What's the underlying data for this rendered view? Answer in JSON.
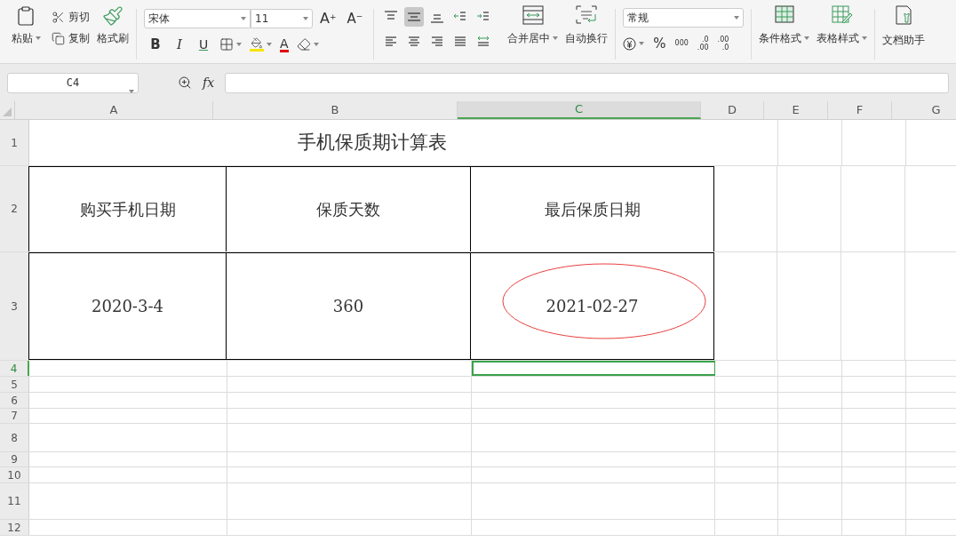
{
  "toolbar": {
    "clipboard": {
      "paste": "粘贴",
      "cut": "剪切",
      "copy": "复制",
      "format_painter": "格式刷"
    },
    "font": {
      "name": "宋体",
      "size": "11",
      "grow": {
        "letter": "A",
        "mark": "+"
      },
      "shrink": {
        "letter": "A",
        "mark": "−"
      },
      "bold": "B",
      "italic": "I",
      "underline": "U",
      "font_color": "A"
    },
    "align_buttons": [
      {
        "kind": "top",
        "selected": false
      },
      {
        "kind": "middle",
        "selected": true
      },
      {
        "kind": "bottom",
        "selected": false
      },
      {
        "kind": "outdent",
        "selected": false
      },
      {
        "kind": "indent",
        "selected": false
      },
      {
        "kind": "left",
        "selected": false
      },
      {
        "kind": "center",
        "selected": false
      },
      {
        "kind": "right",
        "selected": false
      },
      {
        "kind": "justify",
        "selected": false
      },
      {
        "kind": "distributed",
        "selected": false
      }
    ],
    "merge": "合并居中",
    "wrap": "自动换行",
    "number": {
      "format": "常规",
      "percent": "%",
      "thousands": "000",
      "decimal_more": [
        ".0",
        ".00"
      ],
      "decimal_less": [
        ".00",
        ".0"
      ]
    },
    "conditional": "条件格式",
    "table_style": "表格样式",
    "assistant": "文档助手"
  },
  "formula_bar": {
    "name_box": "C4",
    "fx": "fx"
  },
  "columns": [
    {
      "label": "A",
      "selected": false
    },
    {
      "label": "B",
      "selected": false
    },
    {
      "label": "C",
      "selected": true
    },
    {
      "label": "D",
      "selected": false
    },
    {
      "label": "E",
      "selected": false
    },
    {
      "label": "F",
      "selected": false
    },
    {
      "label": "G",
      "selected": false
    }
  ],
  "rows": [
    {
      "label": "1",
      "selected": false,
      "kind": "title",
      "cells": [
        {
          "text": "手机保质期计算表"
        }
      ]
    },
    {
      "label": "2",
      "selected": false,
      "kind": "table",
      "cells": [
        {
          "text": "购买手机日期"
        },
        {
          "text": "保质天数"
        },
        {
          "text": "最后保质日期"
        }
      ]
    },
    {
      "label": "3",
      "selected": false,
      "kind": "table",
      "cells": [
        {
          "text": "2020-3-4"
        },
        {
          "text": "360"
        },
        {
          "text": "2021-02-27",
          "highlighted": true
        }
      ]
    },
    {
      "label": "4",
      "selected": true,
      "kind": "empty",
      "cells": []
    },
    {
      "label": "5",
      "selected": false,
      "kind": "empty",
      "cells": []
    },
    {
      "label": "6",
      "selected": false,
      "kind": "empty",
      "cells": []
    },
    {
      "label": "7",
      "selected": false,
      "kind": "empty",
      "cells": []
    },
    {
      "label": "8",
      "selected": false,
      "kind": "empty",
      "cells": []
    },
    {
      "label": "9",
      "selected": false,
      "kind": "empty",
      "cells": []
    },
    {
      "label": "10",
      "selected": false,
      "kind": "empty",
      "cells": []
    },
    {
      "label": "11",
      "selected": false,
      "kind": "empty",
      "cells": []
    },
    {
      "label": "12",
      "selected": false,
      "kind": "empty",
      "cells": []
    }
  ]
}
